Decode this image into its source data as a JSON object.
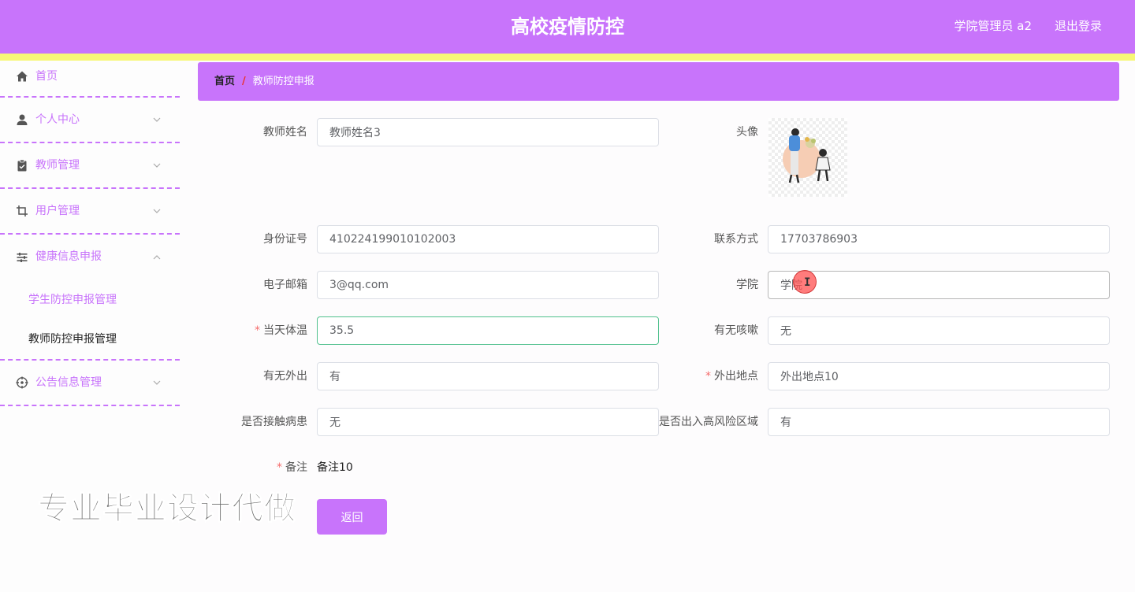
{
  "header": {
    "title": "高校疫情防控",
    "user_label": "学院管理员 a2",
    "logout_label": "退出登录"
  },
  "sidebar": {
    "items": [
      {
        "label": "首页",
        "icon": "home-icon"
      },
      {
        "label": "个人中心",
        "icon": "user-icon"
      },
      {
        "label": "教师管理",
        "icon": "clipboard-icon"
      },
      {
        "label": "用户管理",
        "icon": "crop-icon"
      },
      {
        "label": "健康信息申报",
        "icon": "list-icon",
        "expanded": true,
        "children": [
          {
            "label": "学生防控申报管理"
          },
          {
            "label": "教师防控申报管理"
          }
        ]
      },
      {
        "label": "公告信息管理",
        "icon": "target-icon"
      }
    ]
  },
  "breadcrumb": {
    "home": "首页",
    "separator": "/",
    "current": "教师防控申报"
  },
  "form": {
    "teacher_name": {
      "label": "教师姓名",
      "value": "教师姓名3"
    },
    "avatar": {
      "label": "头像"
    },
    "id_number": {
      "label": "身份证号",
      "value": "410224199010102003"
    },
    "contact": {
      "label": "联系方式",
      "value": "17703786903"
    },
    "email": {
      "label": "电子邮箱",
      "value": "3@qq.com"
    },
    "college": {
      "label": "学院",
      "value": "学院"
    },
    "temperature": {
      "label": "当天体温",
      "value": "35.5",
      "required": "*"
    },
    "cough": {
      "label": "有无咳嗽",
      "value": "无"
    },
    "went_out": {
      "label": "有无外出",
      "value": "有"
    },
    "out_location": {
      "label": "外出地点",
      "value": "外出地点10",
      "required": "*"
    },
    "contact_patient": {
      "label": "是否接触病患",
      "value": "无"
    },
    "high_risk": {
      "label": "是否出入高风险区域",
      "value": "有"
    },
    "remark": {
      "label": "备注",
      "value": "备注10",
      "required": "*"
    },
    "back_label": "返回"
  },
  "watermark": "专业毕业设计代做",
  "colors": {
    "primary": "#c874fb",
    "accent_bar": "#f7f776",
    "required": "#f56c6c",
    "focus_border": "#4fc08d"
  }
}
